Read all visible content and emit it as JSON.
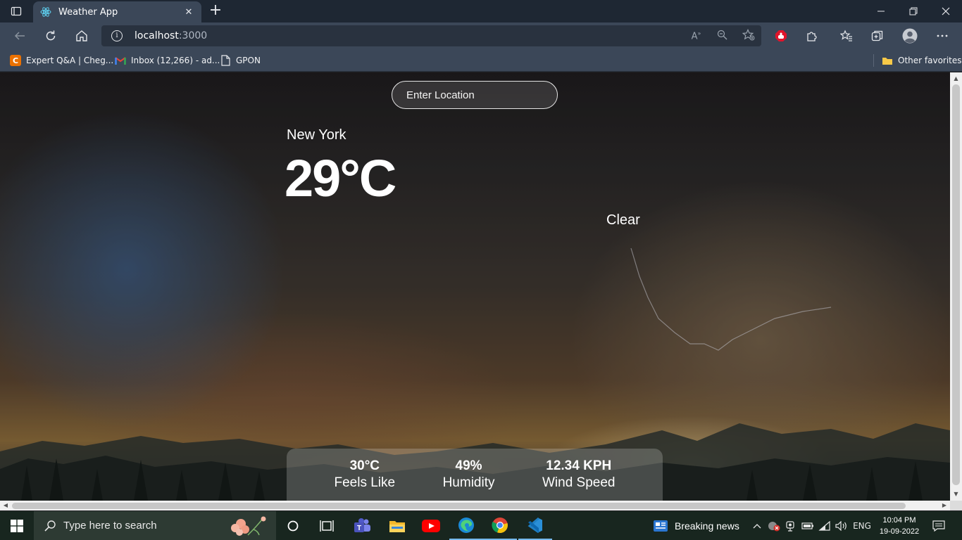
{
  "browser": {
    "tab_title": "Weather App",
    "url_host": "localhost",
    "url_port": ":3000",
    "bookmarks": [
      {
        "label": "Expert Q&A | Cheg...",
        "icon": "chegg-icon"
      },
      {
        "label": "Inbox (12,266) - ad...",
        "icon": "gmail-icon"
      },
      {
        "label": "GPON",
        "icon": "page-icon"
      }
    ],
    "other_favorites": "Other favorites"
  },
  "app": {
    "search_placeholder": "Enter Location",
    "location": "New York",
    "temperature": "29°C",
    "description": "Clear",
    "stats": [
      {
        "value": "30°C",
        "label": "Feels Like"
      },
      {
        "value": "49%",
        "label": "Humidity"
      },
      {
        "value": "12.34 KPH",
        "label": "Wind Speed"
      }
    ]
  },
  "taskbar": {
    "search_placeholder": "Type here to search",
    "news": "Breaking news",
    "language": "ENG",
    "time": "10:04 PM",
    "date": "19-09-2022"
  },
  "colors": {
    "chrome_bg": "#3b4758",
    "taskbar_bg": "#18261f",
    "accent": "#76b9ed"
  }
}
